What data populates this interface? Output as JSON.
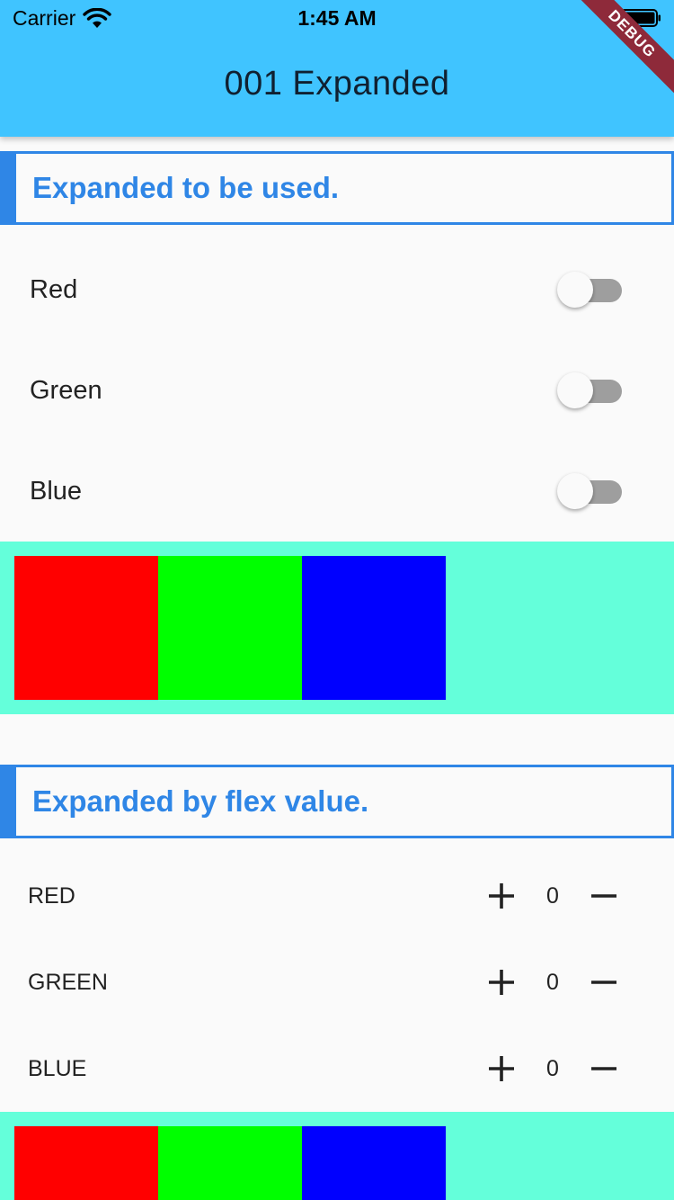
{
  "status_bar": {
    "carrier": "Carrier",
    "time": "1:45 AM"
  },
  "app_bar": {
    "title": "001 Expanded",
    "debug_banner": "DEBUG",
    "color": "#40c4ff"
  },
  "section1": {
    "header": "Expanded to be used.",
    "switches": [
      {
        "label": "Red",
        "on": false
      },
      {
        "label": "Green",
        "on": false
      },
      {
        "label": "Blue",
        "on": false
      }
    ]
  },
  "section2": {
    "header": "Expanded by flex value.",
    "counters": [
      {
        "label": "RED",
        "value": "0"
      },
      {
        "label": "GREEN",
        "value": "0"
      },
      {
        "label": "BLUE",
        "value": "0"
      }
    ]
  },
  "colors": {
    "accent": "#2f86e6",
    "panel_background": "#64ffda",
    "boxes": [
      "#ff0000",
      "#00ff00",
      "#0000ff"
    ]
  },
  "icons": {
    "plus": "plus-icon",
    "minus": "minus-icon",
    "wifi": "wifi-icon",
    "battery": "battery-icon"
  }
}
